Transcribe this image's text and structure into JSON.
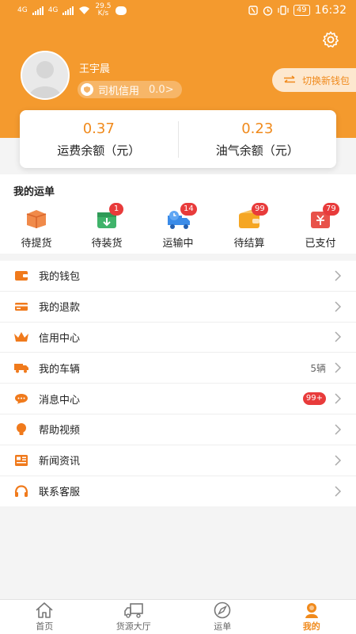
{
  "status_bar": {
    "net1": "4G",
    "net2": "4G",
    "speed_value": "29.5",
    "speed_unit": "K/s",
    "battery": "49",
    "time": "16:32"
  },
  "profile": {
    "username": "王宇晨",
    "credit_label": "司机信用",
    "credit_value": "0.0>",
    "switch_wallet": "切换新钱包"
  },
  "balance": {
    "freight_value": "0.37",
    "freight_label": "运费余额（元）",
    "fuel_value": "0.23",
    "fuel_label": "油气余额（元）"
  },
  "orders": {
    "title": "我的运单",
    "items": [
      {
        "label": "待提货",
        "badge": ""
      },
      {
        "label": "待装货",
        "badge": "1"
      },
      {
        "label": "运输中",
        "badge": "14"
      },
      {
        "label": "待结算",
        "badge": "99"
      },
      {
        "label": "已支付",
        "badge": "79"
      }
    ]
  },
  "menu": [
    {
      "label": "我的钱包",
      "value": ""
    },
    {
      "label": "我的退款",
      "value": ""
    },
    {
      "label": "信用中心",
      "value": ""
    },
    {
      "label": "我的车辆",
      "value": "5辆"
    },
    {
      "label": "消息中心",
      "value": "99+"
    },
    {
      "label": "帮助视频",
      "value": ""
    },
    {
      "label": "新闻资讯",
      "value": ""
    },
    {
      "label": "联系客服",
      "value": ""
    }
  ],
  "nav": [
    {
      "label": "首页",
      "icon": "home-icon"
    },
    {
      "label": "货源大厅",
      "icon": "truck-icon"
    },
    {
      "label": "运单",
      "icon": "compass-icon"
    },
    {
      "label": "我的",
      "icon": "profile-icon"
    }
  ],
  "colors": {
    "brand": "#f49a2e",
    "accent": "#f08a1c",
    "badge": "#e83b3b"
  }
}
